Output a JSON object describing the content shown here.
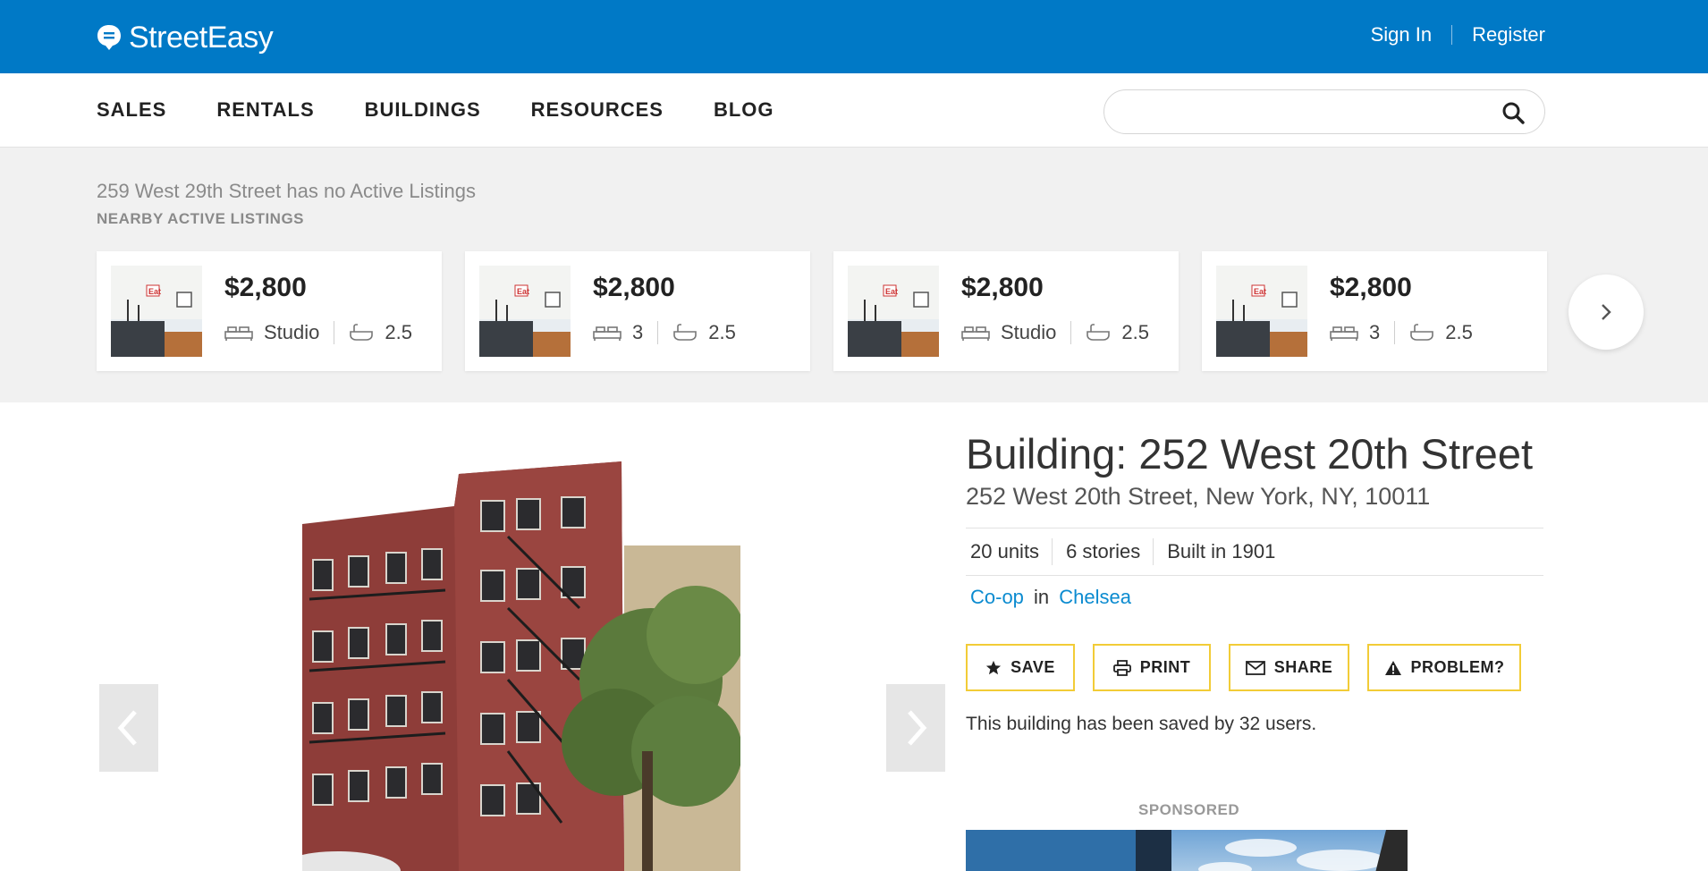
{
  "header": {
    "brand": "StreetEasy",
    "sign_in": "Sign In",
    "register": "Register"
  },
  "nav": {
    "items": [
      "SALES",
      "RENTALS",
      "BUILDINGS",
      "RESOURCES",
      "BLOG"
    ],
    "search_value": ""
  },
  "nearby": {
    "notice": "259 West 29th Street has no Active Listings",
    "label": "NEARBY ACTIVE LISTINGS",
    "listings": [
      {
        "price": "$2,800",
        "beds": "Studio",
        "baths": "2.5"
      },
      {
        "price": "$2,800",
        "beds": "3",
        "baths": "2.5"
      },
      {
        "price": "$2,800",
        "beds": "Studio",
        "baths": "2.5"
      },
      {
        "price": "$2,800",
        "beds": "3",
        "baths": "2.5"
      }
    ]
  },
  "building": {
    "title": "Building: 252 West 20th Street",
    "address": "252 West 20th Street, New York, NY, 10011",
    "facts": [
      "20 units",
      "6 stories",
      "Built in 1901"
    ],
    "type": "Co-op",
    "in_word": "in",
    "neighborhood": "Chelsea",
    "actions": [
      "SAVE",
      "PRINT",
      "SHARE",
      "PROBLEM?"
    ],
    "saved_note": "This building has been saved by 32 users.",
    "sponsored": "SPONSORED"
  },
  "colors": {
    "brand_blue": "#0079c6",
    "link_blue": "#0b8bd0",
    "action_border": "#f2cc37"
  }
}
